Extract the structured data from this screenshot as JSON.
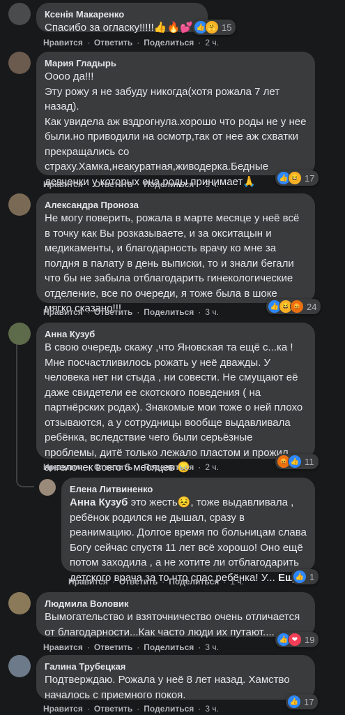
{
  "actions": {
    "like": "Нравится",
    "reply": "Ответить",
    "share": "Поделиться",
    "sep": "·"
  },
  "comments": [
    {
      "author": "Ксенія Макаренко",
      "text": "Спасибо за огласку!!!!!👍🔥💕",
      "time": "2 ч.",
      "reactions": [
        "like",
        "care"
      ],
      "count": "15"
    },
    {
      "author": "Мария Гладырь",
      "text": "Оооо да!!!\nЭту рожу я не забуду никогда(хотя рожала 7 лет назад).\nКак увидела аж вздрогнула.хорошо что роды не у нее были.но приводили на осмотр,так от нее аж схватки прекращались со\nстраху.Хамка,неакуратная,живодерка.Бедные девченки у которых она роды принимает🙏",
      "time": "3 ч.",
      "reactions": [
        "like",
        "haha"
      ],
      "count": "17"
    },
    {
      "author": "Александра Проноза",
      "text": "Не могу поверить, рожала в марте месяце у неё всё в точку как Вы розказываете, и за окситацын и медикаменты, и благодарность врачу ко мне за полдня в палату в день выписки, то и знали бегали что бы не забыла отблагодарить гинекологические отделение, все по очереди, я тоже была в шоке мягко сказано!!!",
      "time": "3 ч.",
      "reactions": [
        "like",
        "haha",
        "angry"
      ],
      "count": "24"
    },
    {
      "author": "Анна Кузуб",
      "text": "В свою очередь скажу ,что Яновская та ещё с...ка ! Мне посчастливилось рожать у неё дважды. У человека нет ни стыда , ни совести. Не смущают её даже свидетели ее скотского поведения ( на партнёрских родах). Знакомые мои тоже о ней плохо отзываются, а у сотрудницы вообще выдавливала ребёнка, вследствие чего были серьёзные проблемы, дитё только лежало пластом и прожил ангелочек всего 6 месяцев 😞",
      "time": "2 ч.",
      "reactions": [
        "angry",
        "like"
      ],
      "count": "11"
    },
    {
      "author": "Елена Литвиненко",
      "mention": "Анна Кузуб",
      "text": " это жесть😣, тоже выдавливала , ребёнок родился не дышал, сразу в реанимацию. Долгое время по больницам слава Богу сейчас спустя 11 лет всё хорошо! Оно ещё потом заходила , а не хотите ли отблагодарить детского врача за то что спас ребёнка! У...",
      "more": "Ещё",
      "time": "1 ч.",
      "reactions": [
        "like"
      ],
      "count": "1"
    },
    {
      "author": "Людмила Воловик",
      "text": "Вымогательство и взяточничество очень отличается от благодарности...Как часто люди их путают....",
      "time": "3 ч.",
      "reactions": [
        "like",
        "love"
      ],
      "count": "19"
    },
    {
      "author": "Галина Трубецкая",
      "text": "Подтверждаю. Рожала у неё 8 лет назад. Хамство началось с приемного покоя.",
      "time": "3 ч.",
      "reactions": [
        "like"
      ],
      "count": "17"
    }
  ],
  "icons": {
    "like": "👍",
    "haha": "😆",
    "angry": "😡",
    "care": "🤗",
    "love": "❤"
  }
}
